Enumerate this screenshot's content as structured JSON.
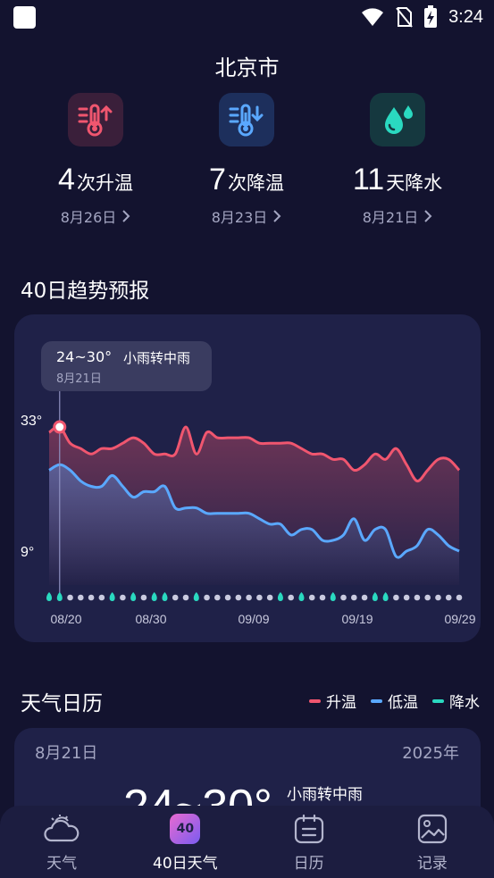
{
  "status_bar": {
    "time": "3:24"
  },
  "city": "北京市",
  "summary": [
    {
      "number": "4",
      "unit": "次升温",
      "date": "8月26日",
      "icon": "thermometer-up-icon",
      "color": "#f0566f"
    },
    {
      "number": "7",
      "unit": "次降温",
      "date": "8月23日",
      "icon": "thermometer-down-icon",
      "color": "#5aa8ff"
    },
    {
      "number": "11",
      "unit": "天降水",
      "date": "8月21日",
      "icon": "water-drops-icon",
      "color": "#2ad9c0"
    }
  ],
  "trend": {
    "title": "40日趋势预报",
    "tooltip": {
      "temp": "24~30°",
      "desc": "小雨转中雨",
      "date": "8月21日"
    },
    "y_labels": {
      "top": "33°",
      "bottom": "9°"
    },
    "x_labels": [
      "08/20",
      "08/30",
      "09/09",
      "09/19",
      "09/29"
    ]
  },
  "chart_data": {
    "type": "line",
    "x": [
      "08/20",
      "08/21",
      "08/22",
      "08/23",
      "08/24",
      "08/25",
      "08/26",
      "08/27",
      "08/28",
      "08/29",
      "08/30",
      "08/31",
      "09/01",
      "09/02",
      "09/03",
      "09/04",
      "09/05",
      "09/06",
      "09/07",
      "09/08",
      "09/09",
      "09/10",
      "09/11",
      "09/12",
      "09/13",
      "09/14",
      "09/15",
      "09/16",
      "09/17",
      "09/18",
      "09/19",
      "09/20",
      "09/21",
      "09/22",
      "09/23",
      "09/24",
      "09/25",
      "09/26",
      "09/27",
      "09/28"
    ],
    "series": [
      {
        "name": "升温",
        "color": "#f0566f",
        "values": [
          31,
          32,
          29,
          28,
          27,
          28,
          28,
          29,
          30,
          29,
          27,
          27,
          27,
          32,
          27,
          31,
          30,
          30,
          30,
          30,
          29,
          29,
          29,
          29,
          28,
          27,
          27,
          26,
          26,
          24,
          25,
          27,
          26,
          28,
          25,
          22,
          24,
          26,
          26,
          24
        ]
      },
      {
        "name": "低温",
        "color": "#5aa8ff",
        "values": [
          24,
          25,
          24,
          22,
          21,
          21,
          23,
          21,
          19,
          20,
          20,
          21,
          17,
          17,
          17,
          16,
          16,
          16,
          16,
          16,
          15,
          14,
          14,
          12,
          13,
          13,
          11,
          11,
          12,
          15,
          11,
          13,
          13,
          8,
          9,
          10,
          13,
          12,
          10,
          9
        ]
      },
      {
        "name": "降水",
        "color": "#2ad9c0",
        "values": [
          1,
          1,
          0,
          0,
          0,
          0,
          1,
          0,
          1,
          0,
          1,
          1,
          0,
          0,
          1,
          0,
          0,
          0,
          0,
          0,
          0,
          0,
          1,
          0,
          1,
          0,
          0,
          1,
          0,
          0,
          0,
          1,
          1,
          0,
          0,
          0,
          0,
          0,
          0,
          0
        ]
      }
    ],
    "ylim": [
      9,
      33
    ],
    "selected_index": 1
  },
  "calendar": {
    "title": "天气日历",
    "legend": [
      {
        "label": "升温",
        "color": "#f0566f"
      },
      {
        "label": "低温",
        "color": "#5aa8ff"
      },
      {
        "label": "降水",
        "color": "#2ad9c0"
      }
    ],
    "date": "8月21日",
    "year": "2025年",
    "temp": "24~30°",
    "desc": "小雨转中雨"
  },
  "nav": [
    {
      "label": "天气",
      "icon": "sun-cloud-icon"
    },
    {
      "label": "40日天气",
      "icon": "forty-day-badge-icon",
      "badge": "40"
    },
    {
      "label": "日历",
      "icon": "calendar-icon"
    },
    {
      "label": "记录",
      "icon": "image-record-icon"
    }
  ]
}
